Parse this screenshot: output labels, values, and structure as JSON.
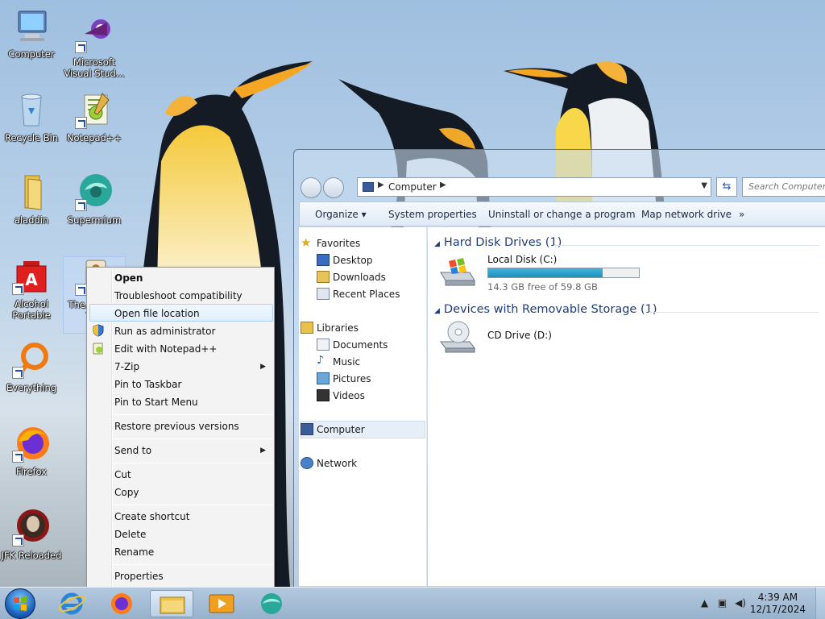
{
  "desktop_icons": [
    {
      "label": "Computer",
      "icon": "computer-icon"
    },
    {
      "label": "Microsoft Visual Stud...",
      "icon": "visual-studio-icon"
    },
    {
      "label": "Recycle Bin",
      "icon": "recycle-bin-icon"
    },
    {
      "label": "Notepad++",
      "icon": "notepadpp-icon"
    },
    {
      "label": "aladdin",
      "icon": "folder-icon"
    },
    {
      "label": "Supermium",
      "icon": "supermium-icon"
    },
    {
      "label": "Alcohol Portable",
      "icon": "alcohol-icon"
    },
    {
      "label": "The... Ala... Tr...",
      "icon": "game-shortcut-icon"
    },
    {
      "label": "Everything",
      "icon": "everything-icon"
    },
    {
      "label": "Firefox",
      "icon": "firefox-icon"
    },
    {
      "label": "JFK Reloaded",
      "icon": "jfk-icon"
    }
  ],
  "context_menu": {
    "items": {
      "open": "Open",
      "troubleshoot": "Troubleshoot compatibility",
      "open_location": "Open file location",
      "run_admin": "Run as administrator",
      "edit_notepad": "Edit with Notepad++",
      "zip": "7-Zip",
      "pin_taskbar": "Pin to Taskbar",
      "pin_start": "Pin to Start Menu",
      "restore": "Restore previous versions",
      "send_to": "Send to",
      "cut": "Cut",
      "copy": "Copy",
      "create_shortcut": "Create shortcut",
      "delete": "Delete",
      "rename": "Rename",
      "properties": "Properties"
    }
  },
  "explorer": {
    "address": "Computer",
    "search_placeholder": "Search Computer",
    "toolbar": {
      "organize": "Organize ▾",
      "system_properties": "System properties",
      "uninstall": "Uninstall or change a program",
      "map_drive": "Map network drive",
      "more": "»"
    },
    "nav": {
      "favorites": "Favorites",
      "desktop": "Desktop",
      "downloads": "Downloads",
      "recent": "Recent Places",
      "libraries": "Libraries",
      "documents": "Documents",
      "music": "Music",
      "pictures": "Pictures",
      "videos": "Videos",
      "computer": "Computer",
      "network": "Network"
    },
    "groups": {
      "hdd": "Hard Disk Drives (1)",
      "removable": "Devices with Removable Storage (1)"
    },
    "drives": {
      "c_name": "Local Disk (C:)",
      "c_free": "14.3 GB free of 59.8 GB",
      "c_used_fraction": 0.76,
      "d_name": "CD Drive (D:)"
    }
  },
  "taskbar": {
    "time": "4:39 AM",
    "date": "12/17/2024"
  },
  "colors": {
    "accent": "#1e3d7a",
    "drive_bar": "#2aa2cc"
  }
}
